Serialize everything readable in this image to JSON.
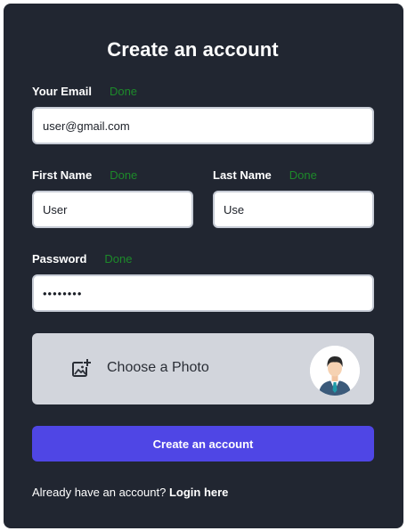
{
  "form": {
    "title": "Create an account",
    "email": {
      "label": "Your Email",
      "status": "Done",
      "value": "user@gmail.com"
    },
    "first_name": {
      "label": "First Name",
      "status": "Done",
      "value": "User"
    },
    "last_name": {
      "label": "Last Name",
      "status": "Done",
      "value": "Use"
    },
    "password": {
      "label": "Password",
      "status": "Done",
      "value": "••••••••"
    },
    "photo": {
      "label": "Choose a Photo",
      "icon": "add-photo-icon"
    },
    "submit_label": "Create an account",
    "footer": {
      "prompt": "Already have an account?",
      "login_link": "Login here"
    }
  },
  "colors": {
    "card_background": "#212631",
    "status_done": "#1d8a2a",
    "primary_button": "#4f46e5",
    "photo_box": "#d2d5dc"
  }
}
